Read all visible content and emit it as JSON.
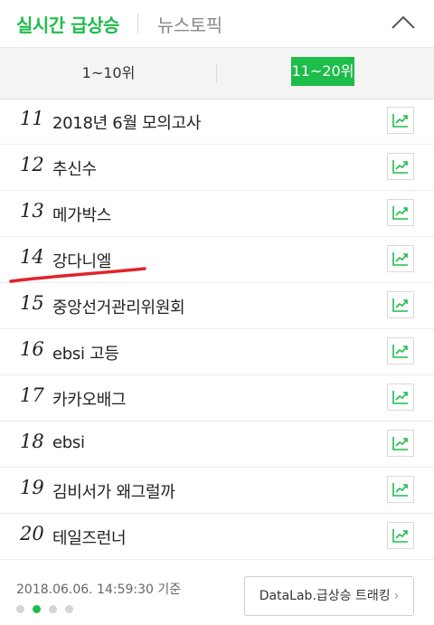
{
  "header": {
    "active_tab": "실시간 급상승",
    "other_tab": "뉴스토픽"
  },
  "range": {
    "left_label": "1~10위",
    "right_label": "11~20위"
  },
  "items": [
    {
      "rank": "11",
      "keyword": "2018년 6월 모의고사"
    },
    {
      "rank": "12",
      "keyword": "추신수"
    },
    {
      "rank": "13",
      "keyword": "메가박스"
    },
    {
      "rank": "14",
      "keyword": "강다니엘"
    },
    {
      "rank": "15",
      "keyword": "중앙선거관리위원회"
    },
    {
      "rank": "16",
      "keyword": "ebsi 고등"
    },
    {
      "rank": "17",
      "keyword": "카카오배그"
    },
    {
      "rank": "18",
      "keyword": "ebsi"
    },
    {
      "rank": "19",
      "keyword": "김비서가 왜그럴까"
    },
    {
      "rank": "20",
      "keyword": "테일즈런너"
    }
  ],
  "footer": {
    "timestamp": "2018.06.06. 14:59:30 기준",
    "datalab_label": "DataLab.급상승 트래킹",
    "chevron": "›",
    "active_page": 2,
    "page_count": 4
  },
  "colors": {
    "accent": "#1dbd4a",
    "annotation": "#e0242a"
  },
  "icons": [
    "chevron-up-icon",
    "trend-chart-icon",
    "chevron-right-icon"
  ]
}
